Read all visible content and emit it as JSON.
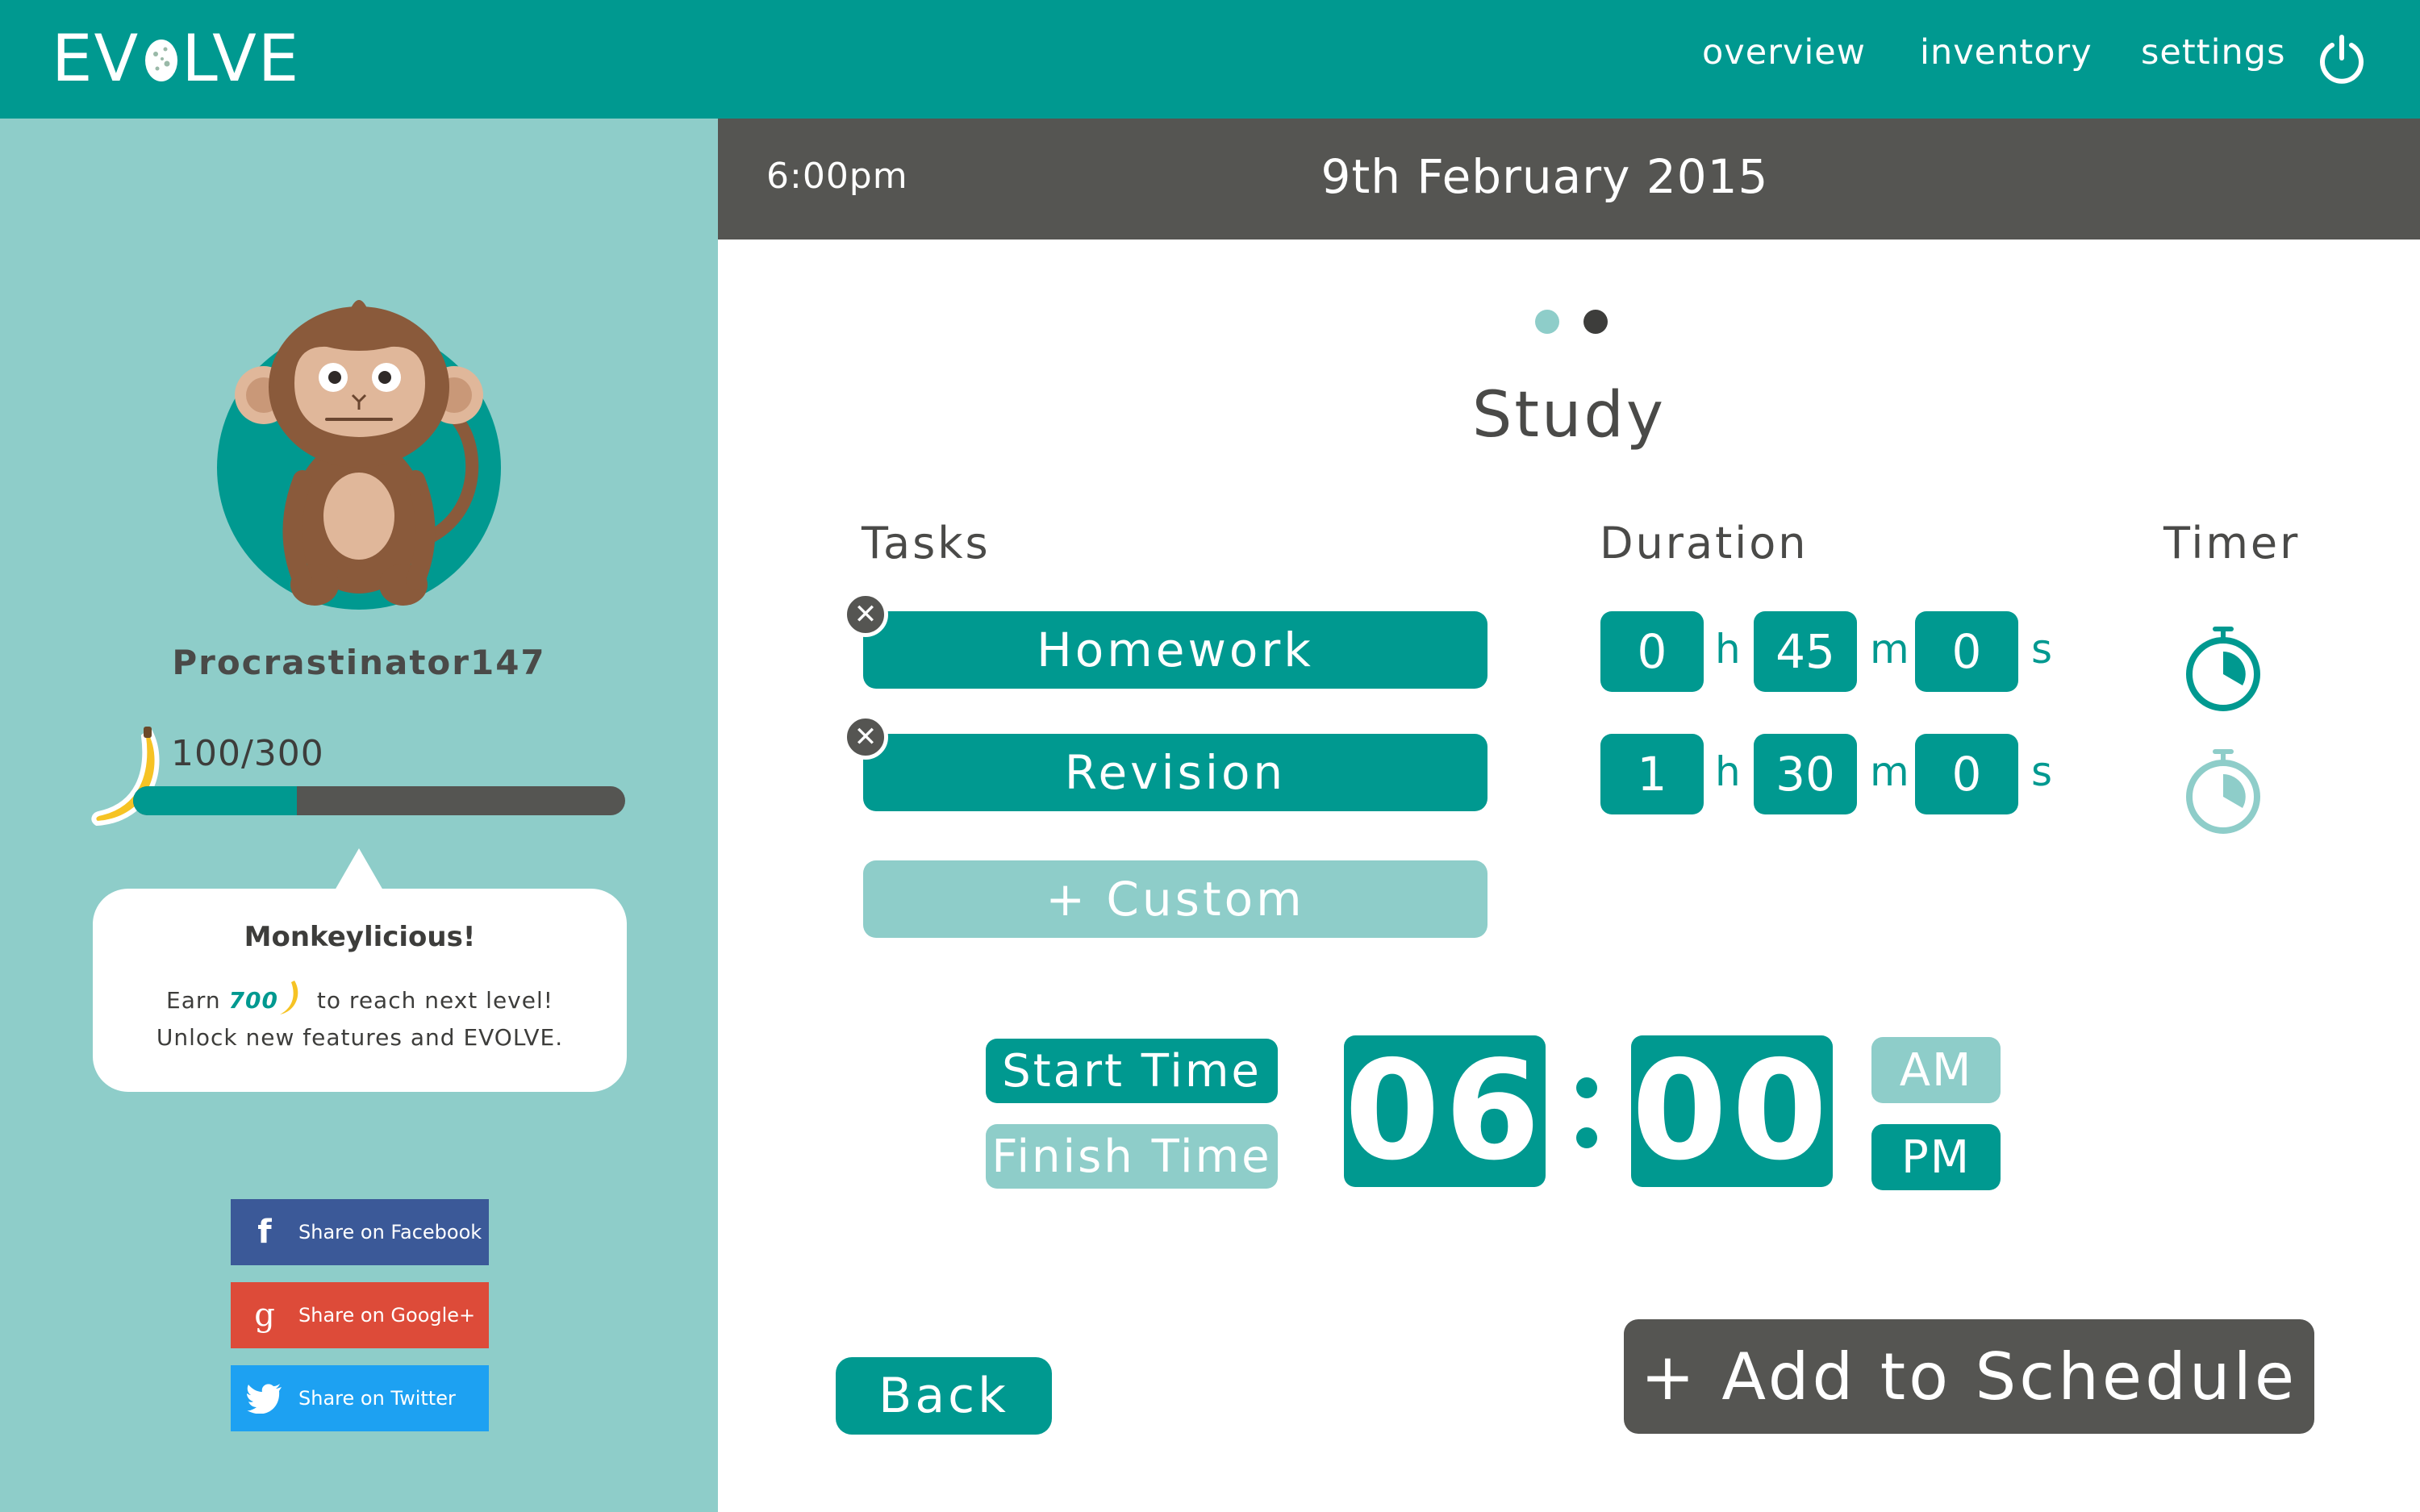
{
  "app": {
    "logo_text_left": "EV",
    "logo_text_right": "LVE"
  },
  "nav": {
    "items": [
      {
        "label": "overview"
      },
      {
        "label": "inventory"
      },
      {
        "label": "settings"
      }
    ],
    "power_icon": "power-icon"
  },
  "profile": {
    "avatar": "monkey-avatar",
    "username": "Procrastinator147",
    "xp_text": "100/300",
    "xp_fraction": 0.3333
  },
  "message": {
    "title": "Monkeylicious!",
    "line1_prefix": "Earn",
    "line1_amount": "700",
    "line1_suffix": "to reach next level!",
    "line2": "Unlock new features and EVOLVE."
  },
  "share": [
    {
      "label": "Share on Facebook",
      "icon": "f",
      "color": "#3b5998"
    },
    {
      "label": "Share on Google+",
      "icon": "g",
      "color": "#dd4b39"
    },
    {
      "label": "Share on Twitter",
      "icon": "twitter-bird",
      "color": "#1da1f2"
    }
  ],
  "header": {
    "time": "6:00pm",
    "date": "9th February 2015"
  },
  "pager": {
    "active_page": 1,
    "page_count": 2
  },
  "section": {
    "title": "Study"
  },
  "columns": {
    "tasks": "Tasks",
    "duration": "Duration",
    "timer": "Timer"
  },
  "tasks": [
    {
      "label": "Homework",
      "hours": "0",
      "minutes": "45",
      "seconds": "0",
      "timer_active": true
    },
    {
      "label": "Revision",
      "hours": "1",
      "minutes": "30",
      "seconds": "0",
      "timer_active": false
    }
  ],
  "units": {
    "h": "h",
    "m": "m",
    "s": "s"
  },
  "custom_button": "+ Custom",
  "time_picker": {
    "start_label": "Start Time",
    "finish_label": "Finish Time",
    "selected": "start",
    "hours": "06",
    "minutes": "00",
    "am": "AM",
    "pm": "PM",
    "meridiem_selected": "PM"
  },
  "actions": {
    "back": "Back",
    "add": "+ Add to Schedule"
  },
  "colors": {
    "teal": "#009990",
    "light_teal": "#8ecdc9",
    "dark_gray": "#555552",
    "white": "#ffffff"
  }
}
